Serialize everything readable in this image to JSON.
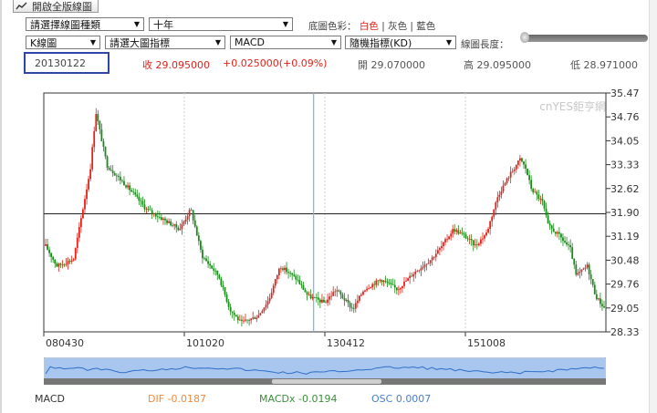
{
  "toolbar": {
    "open_fullscreen_label": "開啟全版線圖",
    "chart_type_select": "請選擇線圖種類",
    "period_select": "十年",
    "bg_color_label": "底圖色彩：",
    "bg_white": "白色",
    "bg_gray": "灰色",
    "bg_blue": "藍色",
    "separator": "|",
    "kline_select": "K線圖",
    "main_indicator_select": "請選大圖指標",
    "sub_indicator_select": "MACD",
    "stochastic_select": "隨機指標(KD)",
    "line_length_label": "線圖長度："
  },
  "quote": {
    "date": "20130122",
    "close": "收 29.095000",
    "change": "+0.025000(+0.09%)",
    "open": "開 29.070000",
    "high": "高 29.095000",
    "low": "低 28.971000"
  },
  "watermark": "cnYES鉅亨網",
  "footer": {
    "macd": "MACD",
    "dif": "DIF -0.0187",
    "macdx": "MACDx -0.0194",
    "osc": "OSC 0.0007"
  },
  "colors": {
    "up": "#e0241b",
    "down": "#1a8a1a",
    "accent_box": "#2f46a8",
    "crosshair": "#6fb7f0",
    "navigator_fill": "#a9c6ee",
    "dif": "#f08a3c",
    "macdx": "#3b8f3b",
    "osc": "#4a7fd0"
  },
  "chart_data": {
    "type": "candlestick",
    "y_ticks": [
      "35.47",
      "34.76",
      "34.05",
      "33.33",
      "32.62",
      "31.90",
      "31.19",
      "30.48",
      "29.76",
      "29.05",
      "28.33"
    ],
    "x_ticks": [
      "080430",
      "101020",
      "130412",
      "151008"
    ],
    "ylim": [
      28.33,
      35.47
    ],
    "horizontal_ref_value": 31.86,
    "grid": true,
    "price_path_approx": [
      {
        "t": 0.0,
        "v": 30.9
      },
      {
        "t": 0.02,
        "v": 30.3
      },
      {
        "t": 0.05,
        "v": 30.5
      },
      {
        "t": 0.08,
        "v": 33.2
      },
      {
        "t": 0.09,
        "v": 34.9
      },
      {
        "t": 0.11,
        "v": 33.3
      },
      {
        "t": 0.15,
        "v": 32.6
      },
      {
        "t": 0.18,
        "v": 32.0
      },
      {
        "t": 0.21,
        "v": 31.7
      },
      {
        "t": 0.24,
        "v": 31.4
      },
      {
        "t": 0.26,
        "v": 32.0
      },
      {
        "t": 0.28,
        "v": 30.6
      },
      {
        "t": 0.31,
        "v": 30.0
      },
      {
        "t": 0.33,
        "v": 29.0
      },
      {
        "t": 0.35,
        "v": 28.6
      },
      {
        "t": 0.38,
        "v": 28.8
      },
      {
        "t": 0.4,
        "v": 29.3
      },
      {
        "t": 0.42,
        "v": 30.3
      },
      {
        "t": 0.45,
        "v": 29.9
      },
      {
        "t": 0.47,
        "v": 29.4
      },
      {
        "t": 0.5,
        "v": 29.2
      },
      {
        "t": 0.52,
        "v": 29.6
      },
      {
        "t": 0.55,
        "v": 29.0
      },
      {
        "t": 0.57,
        "v": 29.6
      },
      {
        "t": 0.6,
        "v": 29.9
      },
      {
        "t": 0.63,
        "v": 29.6
      },
      {
        "t": 0.66,
        "v": 30.1
      },
      {
        "t": 0.69,
        "v": 30.5
      },
      {
        "t": 0.71,
        "v": 30.9
      },
      {
        "t": 0.73,
        "v": 31.4
      },
      {
        "t": 0.75,
        "v": 31.2
      },
      {
        "t": 0.77,
        "v": 30.9
      },
      {
        "t": 0.79,
        "v": 31.3
      },
      {
        "t": 0.81,
        "v": 32.4
      },
      {
        "t": 0.83,
        "v": 33.0
      },
      {
        "t": 0.85,
        "v": 33.5
      },
      {
        "t": 0.86,
        "v": 33.2
      },
      {
        "t": 0.87,
        "v": 32.6
      },
      {
        "t": 0.89,
        "v": 32.2
      },
      {
        "t": 0.9,
        "v": 31.5
      },
      {
        "t": 0.92,
        "v": 31.2
      },
      {
        "t": 0.94,
        "v": 30.8
      },
      {
        "t": 0.95,
        "v": 30.0
      },
      {
        "t": 0.97,
        "v": 30.3
      },
      {
        "t": 0.985,
        "v": 29.4
      },
      {
        "t": 1.0,
        "v": 29.05
      }
    ]
  }
}
